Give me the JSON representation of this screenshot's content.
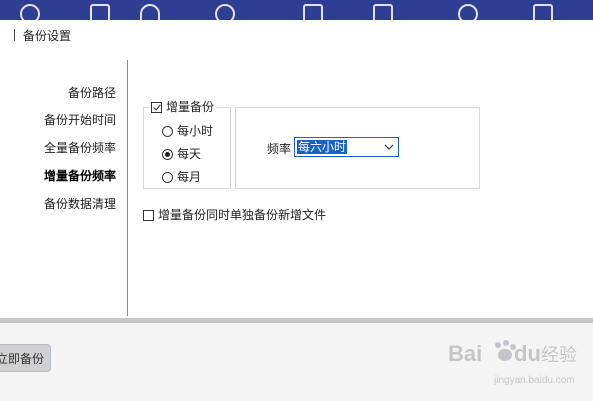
{
  "section_title": "备份设置",
  "nav": {
    "items": [
      {
        "label": "备份路径",
        "active": false
      },
      {
        "label": "备份开始时间",
        "active": false
      },
      {
        "label": "全量备份频率",
        "active": false
      },
      {
        "label": "增量备份频率",
        "active": true
      },
      {
        "label": "备份数据清理",
        "active": false
      }
    ]
  },
  "incremental": {
    "label": "增量备份",
    "checked": true,
    "options": [
      {
        "label": "每小时",
        "selected": false
      },
      {
        "label": "每天",
        "selected": true
      },
      {
        "label": "每月",
        "selected": false
      }
    ]
  },
  "frequency": {
    "label": "频率",
    "value": "每六小时"
  },
  "separate_new_files": {
    "label": "增量备份同时单独备份新增文件",
    "checked": false
  },
  "footer": {
    "backup_now_label": "立即备份"
  },
  "watermark": {
    "brand": "Bai",
    "brand_suffix": "du",
    "text": "经验",
    "url": "jingyan.baidu.com"
  },
  "colors": {
    "topbar": "#2f3d93",
    "accent": "#1a63c4",
    "divider": "#c6c6c6"
  }
}
